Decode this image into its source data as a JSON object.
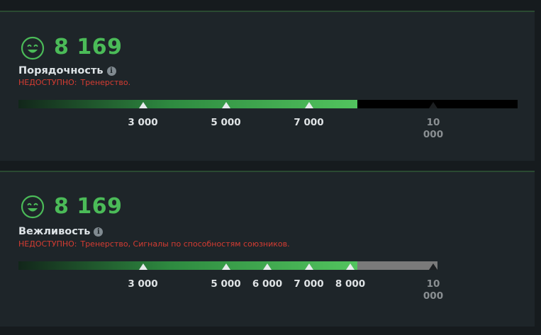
{
  "colors": {
    "panel_bg": "#1e2529",
    "score_green": "#4bbb58",
    "warning_red": "#d53c32",
    "bar_fill_end": "#52c45e"
  },
  "categories": [
    {
      "icon": "smiling-face-icon",
      "score": "8 169",
      "title": "Порядочность",
      "info_icon": "i",
      "unavailable_label": "НЕДОСТУПНО:",
      "unavailable_reasons": "Тренерство.",
      "bar": {
        "max": 10000,
        "value": 8169,
        "track_max_color": "#000000",
        "thresholds": [
          {
            "value": 3000,
            "label": "3 000",
            "reached": true
          },
          {
            "value": 5000,
            "label": "5 000",
            "reached": true
          },
          {
            "value": 7000,
            "label": "7 000",
            "reached": true
          },
          {
            "value": 10000,
            "label": "10 000",
            "reached": false
          }
        ]
      }
    },
    {
      "icon": "smiling-face-icon",
      "score": "8 169",
      "title": "Вежливость",
      "info_icon": "i",
      "unavailable_label": "НЕДОСТУПНО:",
      "unavailable_reasons": "Тренерство, Сигналы по способностям союзников.",
      "bar": {
        "max": 10000,
        "value": 8169,
        "track_max_color": "#7a7a7a",
        "thresholds": [
          {
            "value": 3000,
            "label": "3 000",
            "reached": true
          },
          {
            "value": 5000,
            "label": "5 000",
            "reached": true
          },
          {
            "value": 6000,
            "label": "6 000",
            "reached": true
          },
          {
            "value": 7000,
            "label": "7 000",
            "reached": true
          },
          {
            "value": 8000,
            "label": "8 000",
            "reached": true
          },
          {
            "value": 10000,
            "label": "10 000",
            "reached": false
          }
        ]
      }
    }
  ]
}
